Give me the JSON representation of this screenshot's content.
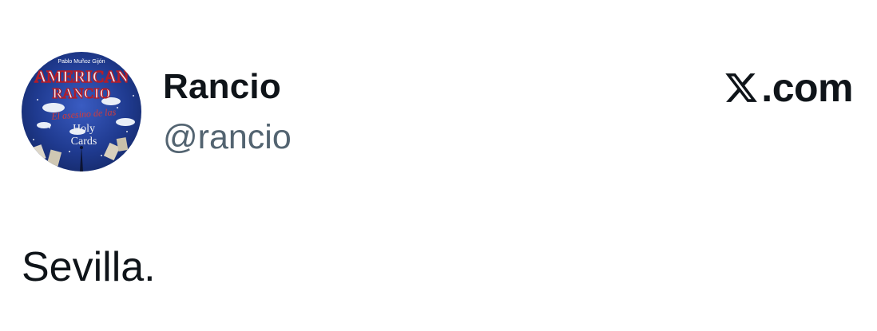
{
  "user": {
    "display_name": "Rancio",
    "handle": "@rancio"
  },
  "avatar": {
    "top_line": "Pablo Muñoz Gijón",
    "title_1": "AMERICAN",
    "title_2": "RANCIO",
    "subtitle": "El asesino de las",
    "subtitle_2": "Holy",
    "subtitle_3": "Cards"
  },
  "brand": {
    "icon": "x-logo-icon",
    "text": ".com"
  },
  "tweet": {
    "text": "Sevilla."
  },
  "colors": {
    "text_primary": "#0f1419",
    "text_secondary": "#536471",
    "background": "#ffffff"
  }
}
